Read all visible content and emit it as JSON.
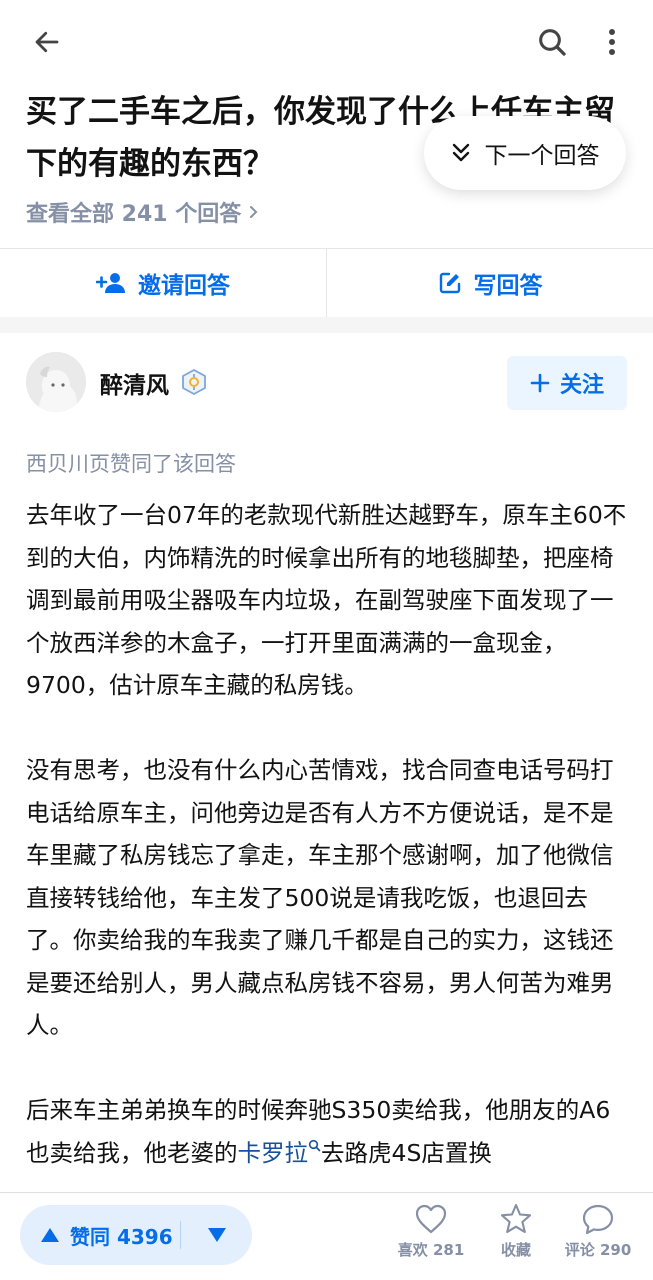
{
  "question": {
    "title": "买了二手车之后，你发现了什么上任车主留下的有趣的东西？",
    "view_all": "查看全部 241 个回答",
    "next_answer": "下一个回答"
  },
  "actions": {
    "invite": "邀请回答",
    "write": "写回答"
  },
  "author": {
    "name": "醉清风",
    "follow": "关注"
  },
  "answer": {
    "voters": "西贝川页赞同了该回答",
    "paragraphs": [
      "去年收了一台07年的老款现代新胜达越野车，原车主60不到的大伯，内饰精洗的时候拿出所有的地毯脚垫，把座椅调到最前用吸尘器吸车内垃圾，在副驾驶座下面发现了一个放西洋参的木盒子，一打开里面满满的一盒现金，9700，估计原车主藏的私房钱。",
      "没有思考，也没有什么内心苦情戏，找合同查电话号码打电话给原车主，问他旁边是否有人方不方便说话，是不是车里藏了私房钱忘了拿走，车主那个感谢啊，加了他微信直接转钱给他，车主发了500说是请我吃饭，也退回去了。你卖给我的车我卖了赚几千都是自己的实力，这钱还是要还给别人，男人藏点私房钱不容易，男人何苦为难男人。"
    ],
    "p3_pre": "后来车主弟弟换车的时候奔驰S350卖给我，他朋友的A6也卖给我，他老婆的",
    "p3_link": "卡罗拉",
    "p3_post": "去路虎4S店置换"
  },
  "bottom": {
    "vote_label": "赞同 4396",
    "like_label": "喜欢 281",
    "fav_label": "收藏",
    "comment_label": "评论 290"
  },
  "colors": {
    "accent": "#056de8",
    "muted": "#8590a6"
  },
  "icons": [
    "back-arrow-icon",
    "search-icon",
    "more-vertical-icon",
    "double-chevron-down-icon",
    "add-user-icon",
    "edit-icon",
    "chevron-right-icon",
    "plus-icon",
    "badge-icon",
    "search-keyword-icon",
    "vote-up-icon",
    "vote-down-icon",
    "heart-icon",
    "star-icon",
    "comment-icon"
  ]
}
